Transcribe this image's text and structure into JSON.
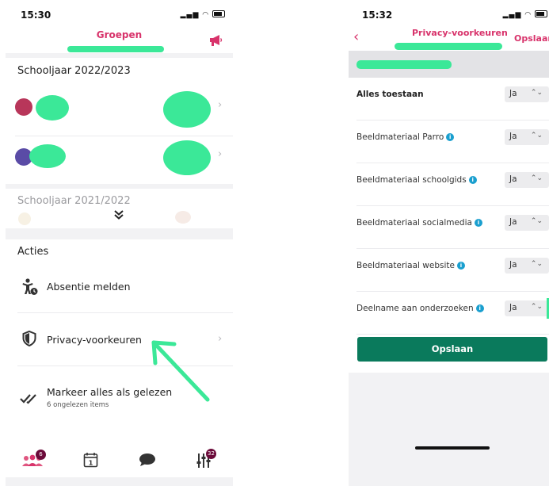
{
  "colors": {
    "brand": "#d8336b",
    "primary_button": "#0a7a5c",
    "badge": "#6b0a3a",
    "info": "#1a9fcf"
  },
  "left": {
    "status": {
      "time": "15:30"
    },
    "header": {
      "title": "Groepen",
      "megaphone_icon": "megaphone-icon"
    },
    "school_year_current": {
      "title": "Schooljaar 2022/2023"
    },
    "school_year_previous": {
      "title": "Schooljaar 2021/2022",
      "expand_icon": "double-chevron-down-icon"
    },
    "actions": {
      "title": "Acties",
      "absence": {
        "label": "Absentie melden",
        "icon": "absence-icon"
      },
      "privacy": {
        "label": "Privacy-voorkeuren",
        "icon": "shield-icon"
      },
      "mark_read": {
        "label": "Markeer alles als gelezen",
        "sub": "6 ongelezen items",
        "icon": "double-check-icon"
      }
    },
    "tabbar": {
      "groups_badge": "6",
      "settings_badge": "32"
    }
  },
  "right": {
    "status": {
      "time": "15:32"
    },
    "header": {
      "title": "Privacy-voorkeuren",
      "save_label": "Opslaan",
      "back_icon": "chevron-left-icon"
    },
    "preferences": [
      {
        "label": "Alles toestaan",
        "value": "Ja",
        "info": false
      },
      {
        "label": "Beeldmateriaal Parro",
        "value": "Ja",
        "info": true
      },
      {
        "label": "Beeldmateriaal schoolgids",
        "value": "Ja",
        "info": true
      },
      {
        "label": "Beeldmateriaal socialmedia",
        "value": "Ja",
        "info": true
      },
      {
        "label": "Beeldmateriaal website",
        "value": "Ja",
        "info": true
      },
      {
        "label": "Deelname aan onderzoeken",
        "value": "Ja",
        "info": true
      }
    ],
    "save_button": "Opslaan"
  }
}
